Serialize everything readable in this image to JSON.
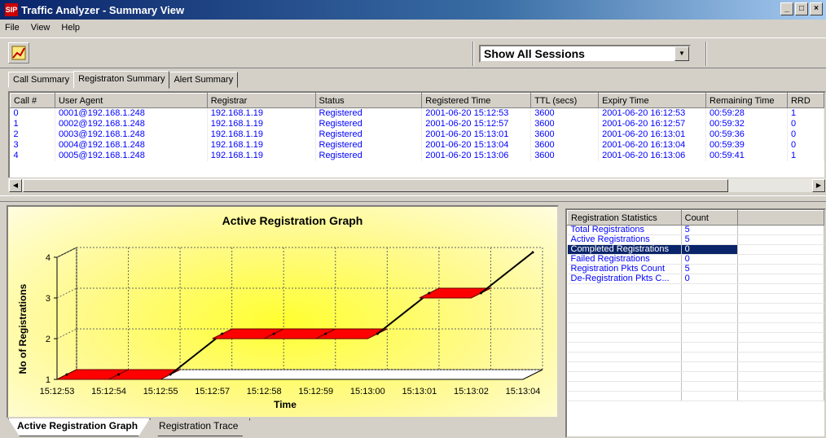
{
  "window": {
    "app_icon": "sip-logo-icon",
    "app_icon_text": "SIP",
    "title": "Traffic Analyzer - Summary View",
    "buttons": [
      "_",
      "□",
      "×"
    ]
  },
  "menu": [
    "File",
    "View",
    "Help"
  ],
  "toolbar": {
    "tool_icon": "graph-tool-icon",
    "sessions_value": "Show All Sessions",
    "dropdown_glyph": "▼"
  },
  "top_tabs": [
    "Call Summary",
    "Registraton Summary",
    "Alert Summary"
  ],
  "active_top_tab": 1,
  "registrations": {
    "columns": [
      "Call #",
      "User Agent",
      "Registrar",
      "Status",
      "Registered Time",
      "TTL (secs)",
      "Expiry Time",
      "Remaining Time",
      "RRD"
    ],
    "rows": [
      [
        "0",
        "0001@192.168.1.248",
        "192.168.1.19",
        "Registered",
        "2001-06-20 15:12:53",
        "3600",
        "2001-06-20 16:12:53",
        "00:59:28",
        "1"
      ],
      [
        "1",
        "0002@192.168.1.248",
        "192.168.1.19",
        "Registered",
        "2001-06-20 15:12:57",
        "3600",
        "2001-06-20 16:12:57",
        "00:59:32",
        "0"
      ],
      [
        "2",
        "0003@192.168.1.248",
        "192.168.1.19",
        "Registered",
        "2001-06-20 15:13:01",
        "3600",
        "2001-06-20 16:13:01",
        "00:59:36",
        "0"
      ],
      [
        "3",
        "0004@192.168.1.248",
        "192.168.1.19",
        "Registered",
        "2001-06-20 15:13:04",
        "3600",
        "2001-06-20 16:13:04",
        "00:59:39",
        "0"
      ],
      [
        "4",
        "0005@192.168.1.248",
        "192.168.1.19",
        "Registered",
        "2001-06-20 15:13:06",
        "3600",
        "2001-06-20 16:13:06",
        "00:59:41",
        "1"
      ]
    ]
  },
  "scroll": {
    "left_glyph": "◀",
    "right_glyph": "▶"
  },
  "chart_data": {
    "type": "line",
    "title": "Active Registration Graph",
    "xlabel": "Time",
    "ylabel": "No of Registrations",
    "categories": [
      "15:12:53",
      "15:12:54",
      "15:12:55",
      "15:12:57",
      "15:12:58",
      "15:12:59",
      "15:13:00",
      "15:13:01",
      "15:13:02",
      "15:13:04"
    ],
    "values": [
      1,
      1,
      1,
      2,
      2,
      2,
      2,
      3,
      3,
      4
    ],
    "ylim": [
      1,
      4
    ],
    "yticks": [
      "1",
      "2",
      "3",
      "4"
    ],
    "grid": true,
    "style": "3d-ribbon",
    "series_color": "#ff0000"
  },
  "bottom_tabs": [
    "Active Registration Graph",
    "Registration Trace"
  ],
  "active_bottom_tab": 0,
  "stats": {
    "columns": [
      "Registration Statistics",
      "Count"
    ],
    "rows": [
      [
        "Total Registrations",
        "5"
      ],
      [
        "Active Registrations",
        "5"
      ],
      [
        "Completed Registrations",
        "0"
      ],
      [
        "Failed Registrations",
        "0"
      ],
      [
        "Registration Pkts Count",
        "5"
      ],
      [
        "De-Registration Pkts C...",
        "0"
      ]
    ],
    "selected_row": 2
  }
}
